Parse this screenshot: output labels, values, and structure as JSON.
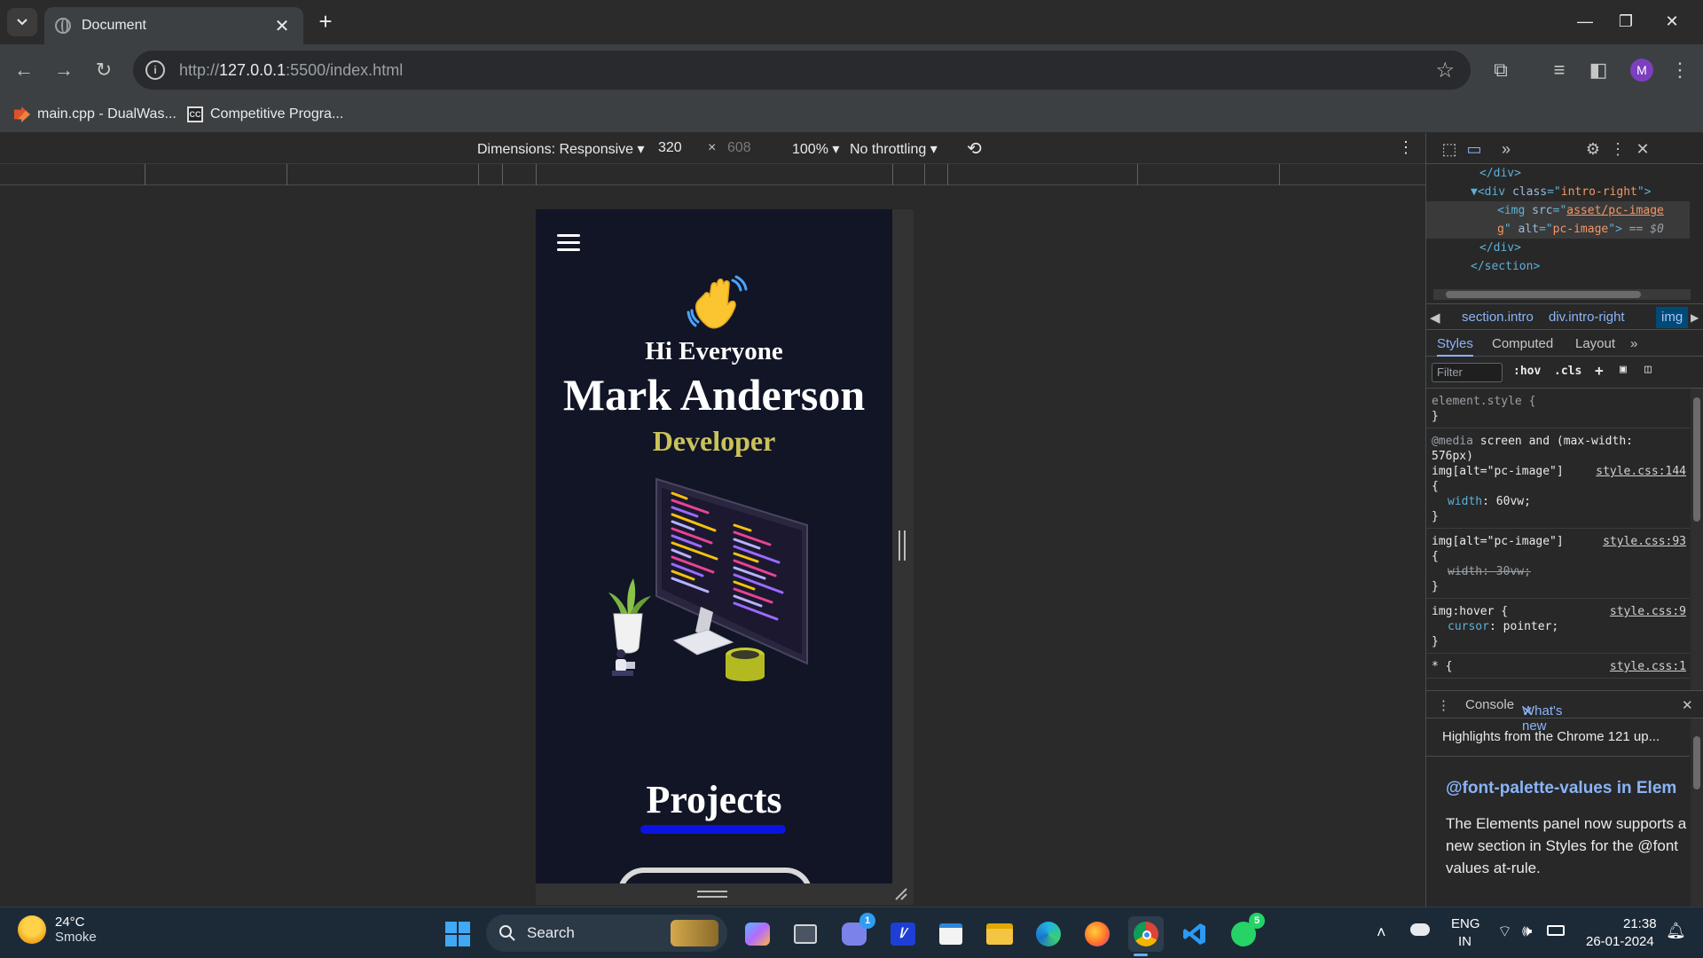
{
  "browser": {
    "tab_title": "Document",
    "url_prefix": "http://",
    "url_host": "127.0.0.1",
    "url_rest": ":5500/index.html",
    "profile_initial": "M",
    "bookmarks": [
      {
        "label": "main.cpp - DualWas..."
      },
      {
        "label": "Competitive Progra...",
        "icon_text": "CC"
      }
    ]
  },
  "device_toolbar": {
    "dimensions": "Dimensions: Responsive ▾",
    "width": "320",
    "times": "×",
    "height": "608",
    "zoom": "100% ▾",
    "throttling": "No throttling ▾"
  },
  "page": {
    "greeting": "Hi Everyone",
    "name": "Mark Anderson",
    "role": "Developer",
    "projects_heading": "Projects"
  },
  "devtools": {
    "dom_lines": [
      {
        "indent": 6,
        "parts": [
          [
            "tag",
            "</div>"
          ]
        ]
      },
      {
        "indent": 5,
        "parts": [
          [
            "tag",
            "▼<div "
          ],
          [
            "attr",
            "class"
          ],
          [
            "tag",
            "=\""
          ],
          [
            "val",
            "intro-right"
          ],
          [
            "tag",
            "\">"
          ]
        ]
      },
      {
        "indent": 8,
        "parts": [
          [
            "tag",
            "<img "
          ],
          [
            "attr",
            "src"
          ],
          [
            "tag",
            "=\""
          ],
          [
            "link",
            "asset/pc-image"
          ]
        ]
      },
      {
        "indent": 8,
        "parts": [
          [
            "link",
            "g"
          ],
          [
            "tag",
            "\" "
          ],
          [
            "attr",
            "alt"
          ],
          [
            "tag",
            "=\""
          ],
          [
            "val",
            "pc-image"
          ],
          [
            "tag",
            "\">"
          ],
          [
            "dim",
            " == $0"
          ]
        ]
      },
      {
        "indent": 6,
        "parts": [
          [
            "tag",
            "</div>"
          ]
        ]
      },
      {
        "indent": 5,
        "parts": [
          [
            "tag",
            "</section>"
          ]
        ]
      }
    ],
    "breadcrumbs": [
      "section.intro",
      "div.intro-right",
      "img"
    ],
    "subtabs": [
      "Styles",
      "Computed",
      "Layout",
      "»"
    ],
    "filter_placeholder": "Filter",
    "hov": ":hov",
    "cls": ".cls",
    "rules": {
      "r1_selector": "element.style {",
      "r1_close": "}",
      "r2_media_kw": "@media",
      "r2_media": " screen and (max-width:",
      "r2_media_2": "576px)",
      "r2_selector": "img[alt=\"pc-image\"]",
      "r2_src": "style.css:144",
      "r2_open": "{",
      "r2_prop": "width",
      "r2_val": ": 60vw;",
      "r2_close": "}",
      "r3_selector": "img[alt=\"pc-image\"]",
      "r3_src": "style.css:93",
      "r3_open": "{",
      "r3_decl": "width: 30vw;",
      "r3_close": "}",
      "r4_selector": "img:hover {",
      "r4_src": "style.css:9",
      "r4_prop": "cursor",
      "r4_val": ": pointer;",
      "r4_close": "}",
      "r5_selector": "* {",
      "r5_src": "style.css:1"
    },
    "drawer_tabs": [
      "Console",
      "What's new"
    ],
    "highlights": "Highlights from the Chrome 121 up...",
    "feature_title": "@font-palette-values in Elem",
    "feature_desc": "The Elements panel now supports a new section in Styles for the @font values at-rule."
  },
  "taskbar": {
    "temp": "24°C",
    "condition": "Smoke",
    "search_label": "Search",
    "teams_badge": "1",
    "whatsapp_badge": "5",
    "lang_1": "ENG",
    "lang_2": "IN",
    "time": "21:38",
    "date": "26-01-2024"
  },
  "colors": {
    "page_bg": "#111526",
    "role_text": "#c9c25a",
    "underline": "#0b13e0",
    "link_blue": "#8ab4f8"
  }
}
